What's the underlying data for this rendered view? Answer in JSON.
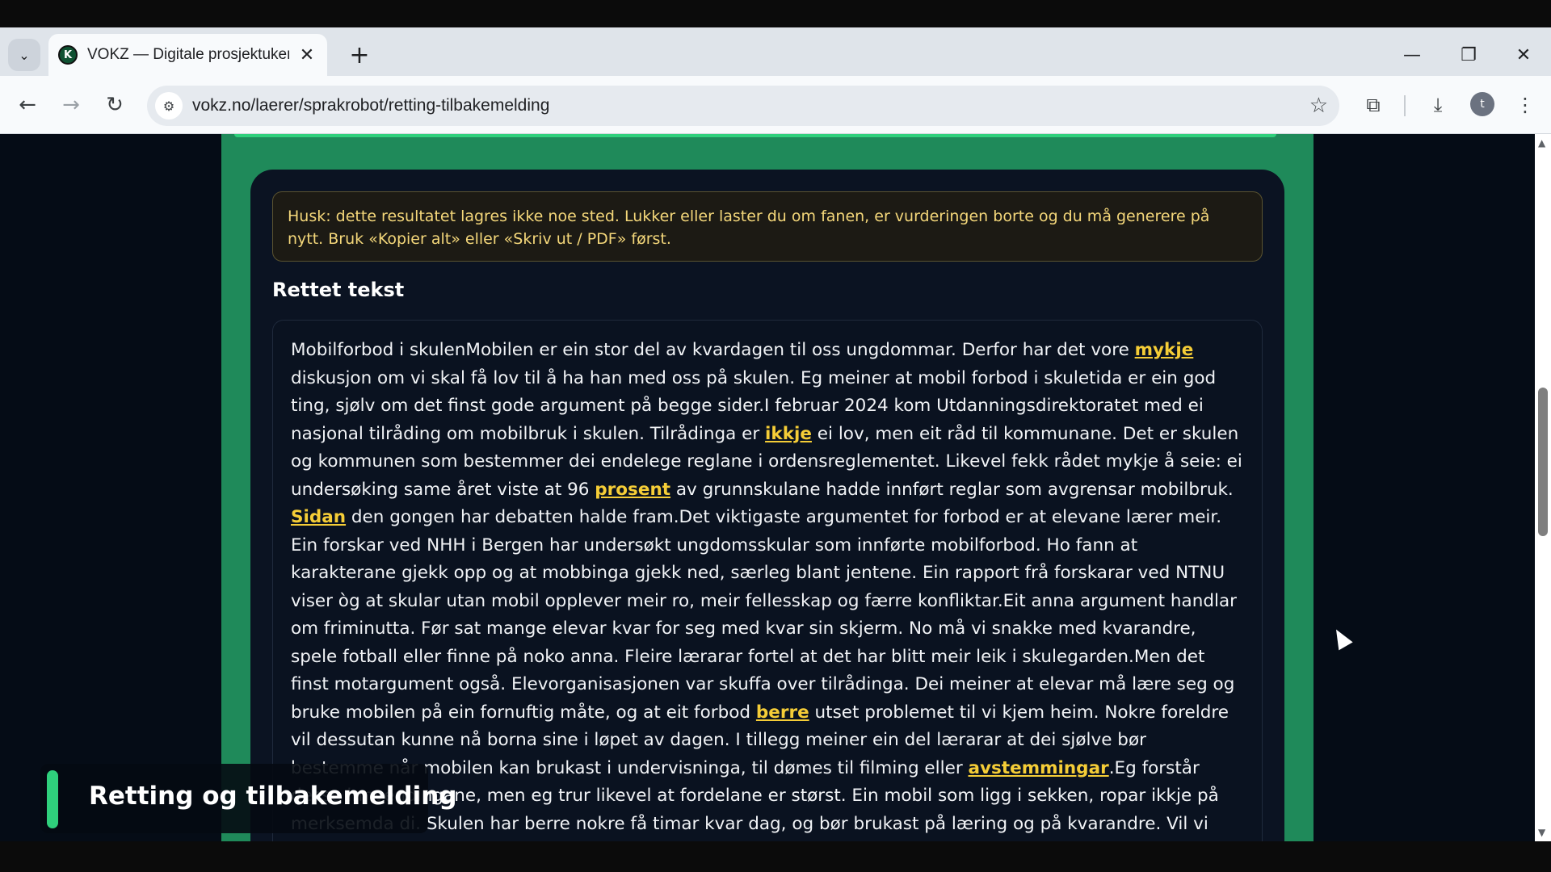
{
  "browser": {
    "tab_title": "VOKZ — Digitale prosjektuker o",
    "tab_favicon": "K",
    "url": "vokz.no/laerer/sprakrobot/retting-tilbakemelding",
    "profile_initial": "t",
    "icons": {
      "tab_list": "chevron-down-icon",
      "close": "close-icon",
      "new_tab": "plus-icon",
      "back": "back-arrow-icon",
      "forward": "forward-arrow-icon",
      "reload": "reload-icon",
      "site_info": "tune-icon",
      "bookmark": "star-icon",
      "extensions": "puzzle-icon",
      "downloads": "download-icon",
      "menu": "kebab-menu-icon"
    }
  },
  "page": {
    "notice": "Husk: dette resultatet lagres ikke noe sted. Lukker eller laster du om fanen, er vurderingen borte og du må generere på nytt. Bruk «Kopier alt» eller «Skriv ut / PDF» først.",
    "section_title": "Rettet tekst",
    "text_segments": [
      {
        "t": "Mobilforbod i skulenMobilen er ein stor del av kvardagen til oss ungdommar. Derfor har det vore "
      },
      {
        "t": "mykje",
        "fix": true
      },
      {
        "t": " diskusjon om vi skal få lov til å ha han med oss på skulen. Eg meiner at mobil forbod i skuletida er ein god ting, sjølv om det finst gode argument på begge sider.I februar 2024 kom Utdanningsdirektoratet med ei nasjonal tilråding om mobilbruk i skulen. Tilrådinga er "
      },
      {
        "t": "ikkje",
        "fix": true
      },
      {
        "t": " ei lov, men eit råd til kommunane. Det er skulen og kommunen som bestemmer dei endelege reglane i ordensreglementet. Likevel fekk rådet mykje å seie: ei undersøking same året viste at 96 "
      },
      {
        "t": "prosent",
        "fix": true
      },
      {
        "t": " av grunnskulane hadde innført reglar som avgrensar mobilbruk. "
      },
      {
        "t": "Sidan",
        "fix": true
      },
      {
        "t": " den gongen har debatten halde fram.Det viktigaste argumentet for forbod er at elevane lærer meir. Ein forskar ved NHH i Bergen har undersøkt ungdomsskular som innførte mobilforbod. Ho fann at karakterane gjekk opp og at mobbinga gjekk ned, særleg blant jentene. Ein rapport frå forskarar ved NTNU viser òg at skular utan mobil opplever meir ro, meir fellesskap og færre konfliktar.Eit anna argument handlar om friminutta. Før sat mange elevar kvar for seg med kvar sin skjerm. No må vi snakke med kvarandre, spele fotball eller finne på noko anna. Fleire lærarar fortel at det har blitt meir leik i skulegarden.Men det finst motargument også. Elevorganisasjonen var skuffa over tilrådinga. Dei meiner at elevar må lære seg og bruke mobilen på ein fornuftig måte, og at eit forbod "
      },
      {
        "t": "berre",
        "fix": true
      },
      {
        "t": " utset problemet til vi kjem heim. Nokre foreldre vil dessutan kunne nå borna sine i løpet av dagen. I tillegg meiner ein del lærarar at dei sjølve bør bestemme når mobilen kan brukast i undervisninga, til dømes til filming eller "
      },
      {
        "t": "avstemmingar",
        "fix": true
      },
      {
        "t": ".Eg forstår desse innvendingane, men eg trur likevel at fordelane er størst. Ein mobil som ligg i sekken, ropar ikkje på merksemda di. Skulen har berre nokre få timar kvar dag, og bør brukast på læring og på kvarandre. Vil vi lære å bruke mobilen med måte, kan vi øve på det heime og i fritida.Konklusjonen min er derfor at mobilforbodet bør halde fram, men at lærarane må få lov til å opne for mobil når"
      }
    ],
    "toast_title": "Retting og tilbakemelding",
    "colors": {
      "accent_green": "#1f8a5a",
      "highlight": "#f5cd37",
      "notice_text": "#f4d77a"
    }
  }
}
